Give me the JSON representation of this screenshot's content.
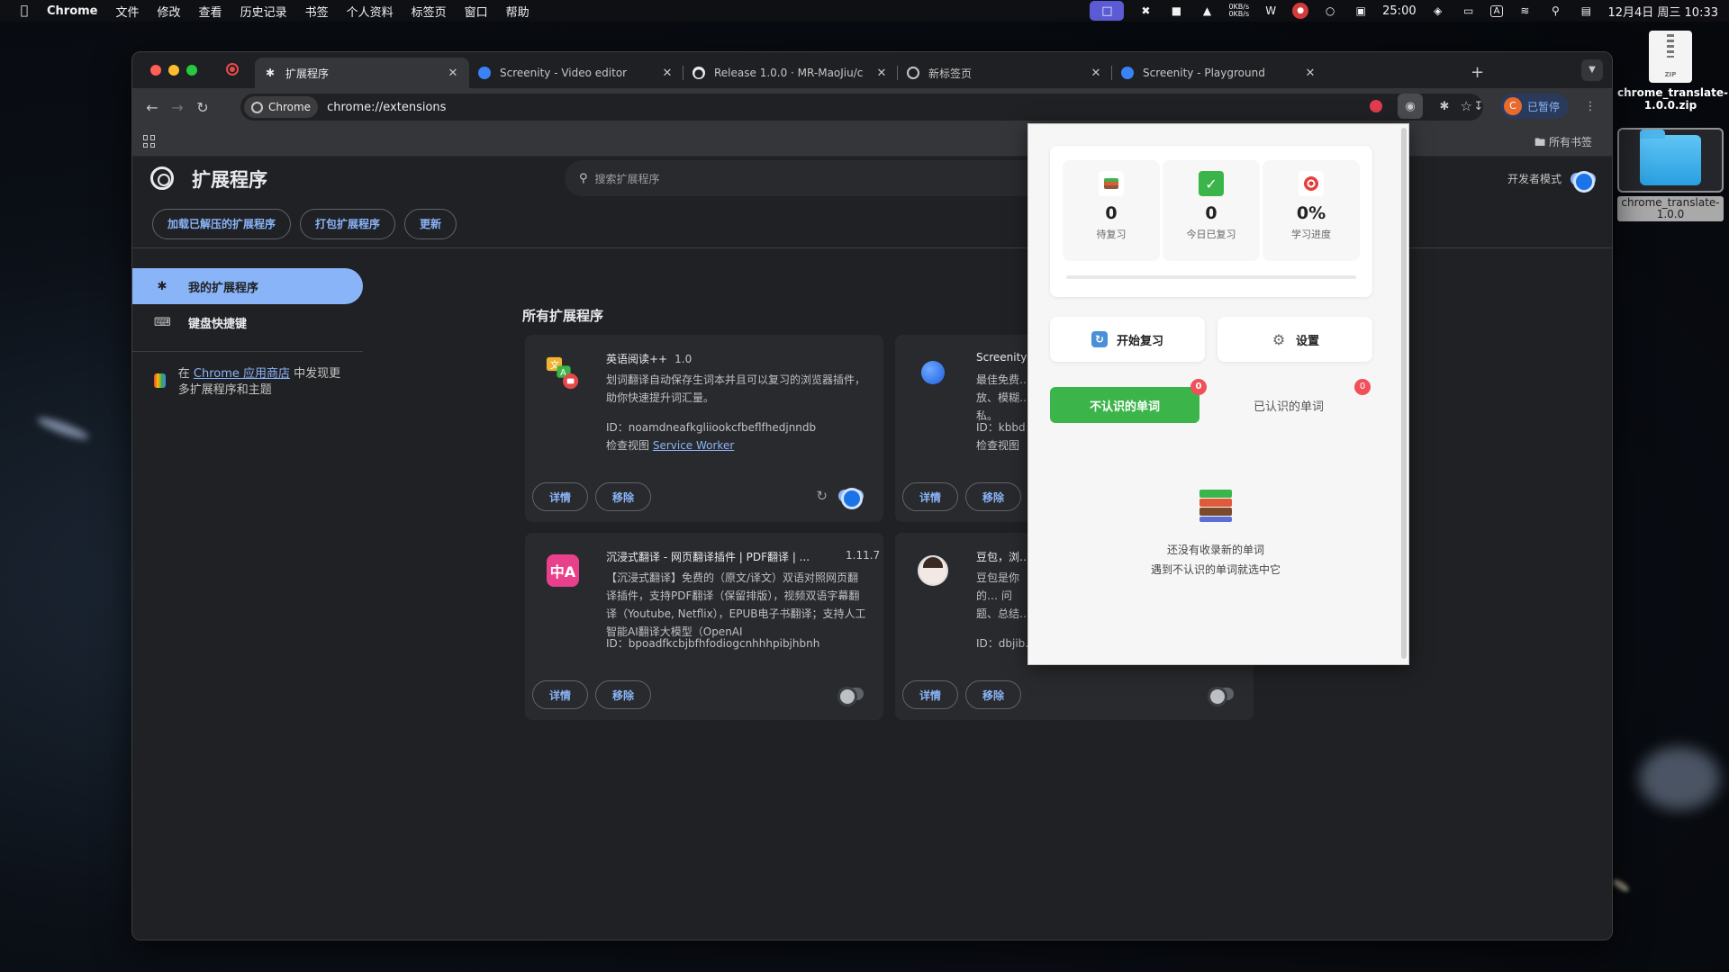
{
  "menubar": {
    "app_name": "Chrome",
    "items": [
      "文件",
      "修改",
      "查看",
      "历史记录",
      "书签",
      "个人资料",
      "标签页",
      "窗口",
      "帮助"
    ],
    "net_up": "0KB/s",
    "net_down": "0KB/s",
    "timer": "25:00",
    "input_method": "A",
    "clock": "12月4日 周三  10:33"
  },
  "desktop": {
    "zip_label": "chrome_translate-1.0.0.zip",
    "zip_badge": "ZIP",
    "folder_label": "chrome_translate-1.0.0"
  },
  "tabs": [
    {
      "label": "扩展程序",
      "active": true
    },
    {
      "label": "Screenity - Video editor",
      "active": false
    },
    {
      "label": "Release 1.0.0 · MR-MaoJiu/c",
      "active": false
    },
    {
      "label": "新标签页",
      "active": false
    },
    {
      "label": "Screenity - Playground",
      "active": false
    }
  ],
  "omnibox": {
    "chip": "Chrome",
    "url": "chrome://extensions"
  },
  "profile": {
    "initial": "C",
    "status": "已暂停"
  },
  "bookmarks": {
    "all_label": "所有书签"
  },
  "page": {
    "title": "扩展程序",
    "search_placeholder": "搜索扩展程序",
    "dev_mode_label": "开发者模式",
    "dev_mode_on": true,
    "actions": [
      "加载已解压的扩展程序",
      "打包扩展程序",
      "更新"
    ],
    "sidebar": {
      "my_extensions": "我的扩展程序",
      "shortcuts": "键盘快捷键",
      "store_prefix": "在 ",
      "store_link": "Chrome 应用商店",
      "store_suffix": " 中发现更多扩展程序和主题"
    },
    "section_title": "所有扩展程序",
    "details_label": "详情",
    "remove_label": "移除",
    "extensions": [
      {
        "name": "英语阅读++",
        "version": "1.0",
        "description": "划词翻译自动保存生词本并且可以复习的浏览器插件，助你快速提升词汇量。",
        "id_text": "ID：noamdneafkgliiookcfbeflfhedjnndb",
        "inspect_prefix": "检查视图 ",
        "inspect_link": "Service Worker",
        "enabled": true
      },
      {
        "name": "Screenity",
        "version": "",
        "description": "最佳免费… 放、模糊… 私。",
        "id_text": "ID：kbbd",
        "inspect_prefix": "检查视图",
        "inspect_link": "",
        "enabled": true
      },
      {
        "name": "沉浸式翻译 - 网页翻译插件 | PDF翻译 | ...",
        "version": "1.11.7",
        "description": "【沉浸式翻译】免费的（原文/译文）双语对照网页翻译插件，支持PDF翻译（保留排版），视频双语字幕翻译（Youtube, Netflix），EPUB电子书翻译；支持人工智能AI翻译大模型（OpenAI",
        "id_text": "ID：bpoadfkcbjbfhfodiogcnhhhpibjhbnh",
        "enabled": false
      },
      {
        "name": "豆包，浏…",
        "version": "",
        "description": "豆包是你的… 问题、总结… 写邮件。",
        "id_text": "ID：dbjib…",
        "enabled": false
      }
    ]
  },
  "popup": {
    "stats": [
      {
        "value": "0",
        "label": "待复习",
        "icon": "books-icon"
      },
      {
        "value": "0",
        "label": "今日已复习",
        "icon": "check-icon"
      },
      {
        "value": "0%",
        "label": "学习进度",
        "icon": "target-icon"
      }
    ],
    "progress": 0,
    "start_review": "开始复习",
    "settings": "设置",
    "tab_unknown": "不认识的单词",
    "tab_unknown_count": "0",
    "tab_known": "已认识的单词",
    "tab_known_count": "0",
    "empty_line1": "还没有收录新的单词",
    "empty_line2": "遇到不认识的单词就选中它",
    "colors": {
      "accent": "#3bb54a",
      "badge": "#f0505a"
    }
  }
}
